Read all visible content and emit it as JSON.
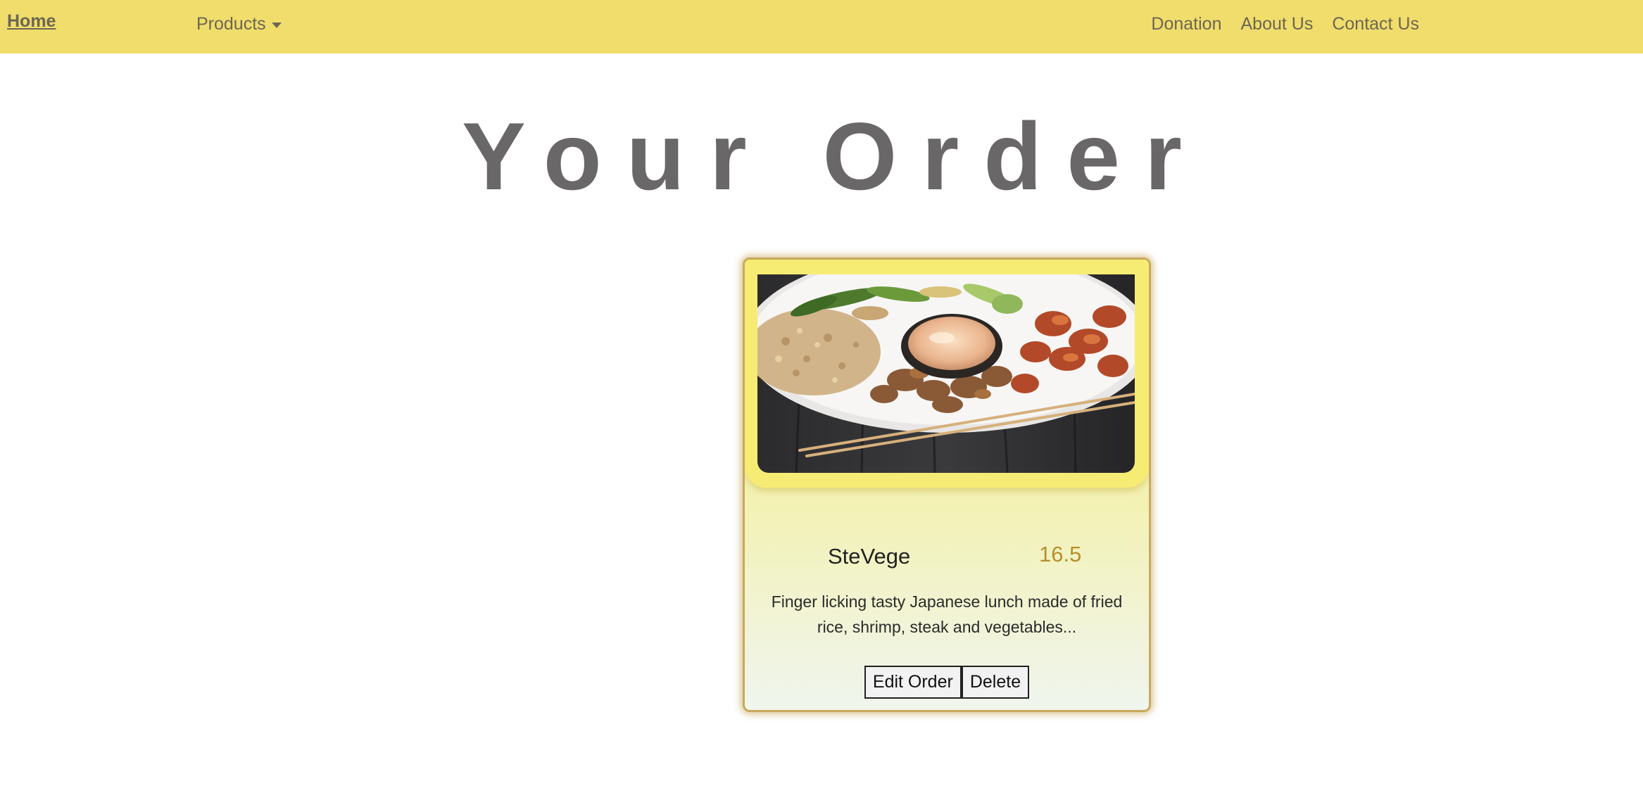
{
  "nav": {
    "home": "Home",
    "products": "Products",
    "links": [
      "Donation",
      "About Us",
      "Contact Us"
    ]
  },
  "page_title": "Your Order",
  "order_card": {
    "name": "SteVege",
    "price": "16.5",
    "description": "Finger licking tasty Japanese lunch made of fried rice, shrimp, steak and vegetables...",
    "edit_label": "Edit Order",
    "delete_label": "Delete",
    "image_alt": "food-photo-japanese-lunch-plate"
  },
  "colors": {
    "navbar": "#f0dd6c",
    "nav_text": "#6d6653",
    "title": "#696767",
    "price": "#b78f2b",
    "card_border": "#c9a95a"
  }
}
